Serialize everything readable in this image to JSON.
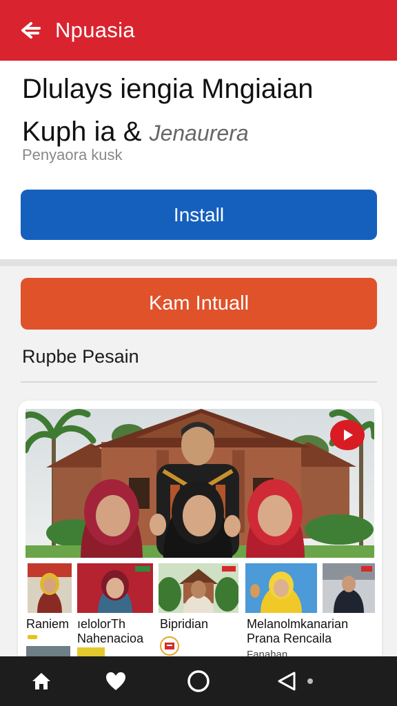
{
  "appbar": {
    "title": "Npuasia",
    "back_icon": "back-arrow-icon"
  },
  "header": {
    "title_line1": "Dlulays iengia Mngiaian",
    "title_line2_main": "Kuph ia & ",
    "title_line2_em": "Jenaurera",
    "subtitle": "Penyaora kusk",
    "install_label": "Install"
  },
  "secondary": {
    "button_label": "Kam Intuall",
    "section_label": "Rupbe Pesain"
  },
  "media": {
    "play_icon": "youtube-play-icon",
    "thumbs": [
      {
        "label": "Raniem"
      },
      {
        "label": "ıelolorTh Nahenacioa"
      },
      {
        "label": "Bipridian"
      },
      {
        "label": "Melanolmkanarian Prana Rencaila"
      },
      {
        "label": ""
      }
    ],
    "cutoff_label": "Fanahan"
  },
  "nav": {
    "items": [
      {
        "icon": "home-icon"
      },
      {
        "icon": "heart-icon"
      },
      {
        "icon": "circle-icon"
      },
      {
        "icon": "back-triangle-icon"
      }
    ]
  },
  "colors": {
    "appbar": "#d9242f",
    "install": "#1560bd",
    "secondary": "#e0522a",
    "navbar": "#1d1d1d"
  }
}
